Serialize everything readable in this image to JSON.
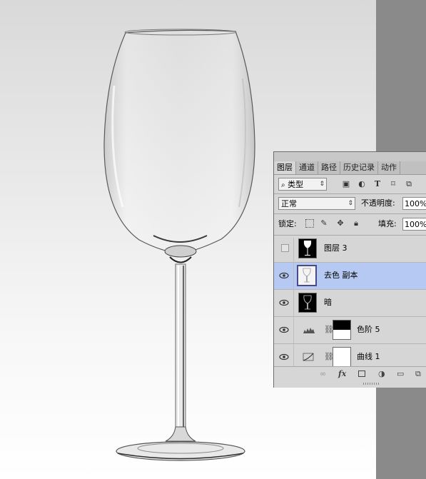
{
  "panel": {
    "tabs": [
      "图层",
      "通道",
      "路径",
      "历史记录",
      "动作"
    ],
    "active_tab": "图层",
    "filter": {
      "selected": "类型",
      "icons": [
        "image-filter-icon",
        "adjustment-filter-icon",
        "type-filter-icon",
        "shape-filter-icon",
        "smart-object-filter-icon"
      ]
    },
    "blend_mode": "正常",
    "opacity_label": "不透明度:",
    "opacity_value": "100%",
    "lock_label": "锁定:",
    "fill_label": "填充:",
    "fill_value": "100%",
    "layers": [
      {
        "name": "图层 3",
        "visible": false,
        "selected": false,
        "thumb": "glass-white-on-black"
      },
      {
        "name": "去色 副本",
        "visible": true,
        "selected": true,
        "thumb": "glass-grey"
      },
      {
        "name": "暗",
        "visible": true,
        "selected": false,
        "thumb": "glass-black"
      },
      {
        "name": "色阶 5",
        "visible": true,
        "selected": false,
        "thumb": "levels-mask",
        "adjustment": "levels-icon"
      },
      {
        "name": "曲线 1",
        "visible": true,
        "selected": false,
        "thumb": "curves-mask",
        "adjustment": "curves-icon"
      }
    ],
    "footer_icons": [
      "link-icon",
      "fx-icon",
      "mask-icon",
      "adjustment-icon",
      "folder-icon",
      "new-layer-icon"
    ]
  },
  "footer": {
    "fx_label": "fx"
  },
  "colors": {
    "selection": "#b5c9f2",
    "panel_bg": "#d6d6d6",
    "pasteboard": "#8a8a8a"
  }
}
